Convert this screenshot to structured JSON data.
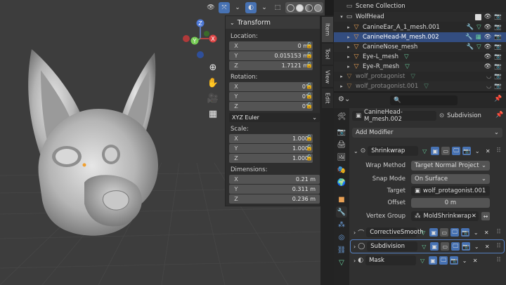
{
  "npanel": {
    "title": "Transform",
    "location_label": "Location:",
    "location": [
      {
        "axis": "X",
        "value": "0 m"
      },
      {
        "axis": "Y",
        "value": "0.015153 m"
      },
      {
        "axis": "Z",
        "value": "1.7121 m"
      }
    ],
    "rotation_label": "Rotation:",
    "rotation": [
      {
        "axis": "X",
        "value": "0°"
      },
      {
        "axis": "Y",
        "value": "0°"
      },
      {
        "axis": "Z",
        "value": "0°"
      }
    ],
    "rotation_mode": "XYZ Euler",
    "scale_label": "Scale:",
    "scale": [
      {
        "axis": "X",
        "value": "1.000"
      },
      {
        "axis": "Y",
        "value": "1.000"
      },
      {
        "axis": "Z",
        "value": "1.000"
      }
    ],
    "dimensions_label": "Dimensions:",
    "dimensions": [
      {
        "axis": "X",
        "value": "0.21 m"
      },
      {
        "axis": "Y",
        "value": "0.311 m"
      },
      {
        "axis": "Z",
        "value": "0.236 m"
      }
    ],
    "tabs": [
      "Item",
      "Tool",
      "View",
      "Edit"
    ]
  },
  "gizmo": {
    "x": "X",
    "y": "Y",
    "z": "Z"
  },
  "outliner": {
    "scene_collection": "Scene Collection",
    "collection": "WolfHead",
    "items": [
      {
        "name": "CanineEar_A_1_mesh.001",
        "selected": false
      },
      {
        "name": "CanineHead-M_mesh.002",
        "selected": true
      },
      {
        "name": "CanineNose_mesh",
        "selected": false
      },
      {
        "name": "Eye-L_mesh",
        "selected": false
      },
      {
        "name": "Eye-R_mesh",
        "selected": false
      }
    ],
    "outside_items": [
      "wolf_protagonist",
      "wolf_protagonist.001"
    ]
  },
  "properties": {
    "search_placeholder": "",
    "object_name": "CanineHead-M_mesh.002",
    "active_modifier": "Subdivision",
    "add_modifier": "Add Modifier",
    "shrinkwrap": {
      "name": "Shrinkwrap",
      "wrap_method_label": "Wrap Method",
      "wrap_method": "Target Normal Project",
      "snap_mode_label": "Snap Mode",
      "snap_mode": "On Surface",
      "target_label": "Target",
      "target": "wolf_protagonist.001",
      "offset_label": "Offset",
      "offset": "0 m",
      "vertex_group_label": "Vertex Group",
      "vertex_group": "MoldShrinkwrap"
    },
    "modifiers": [
      "CorrectiveSmooth",
      "Subdivision",
      "Mask"
    ]
  },
  "colors": {
    "accent": "#4772b3",
    "mesh_icon": "#e8a054",
    "data_icon": "#6ad09e",
    "selected_row": "#334d80"
  }
}
